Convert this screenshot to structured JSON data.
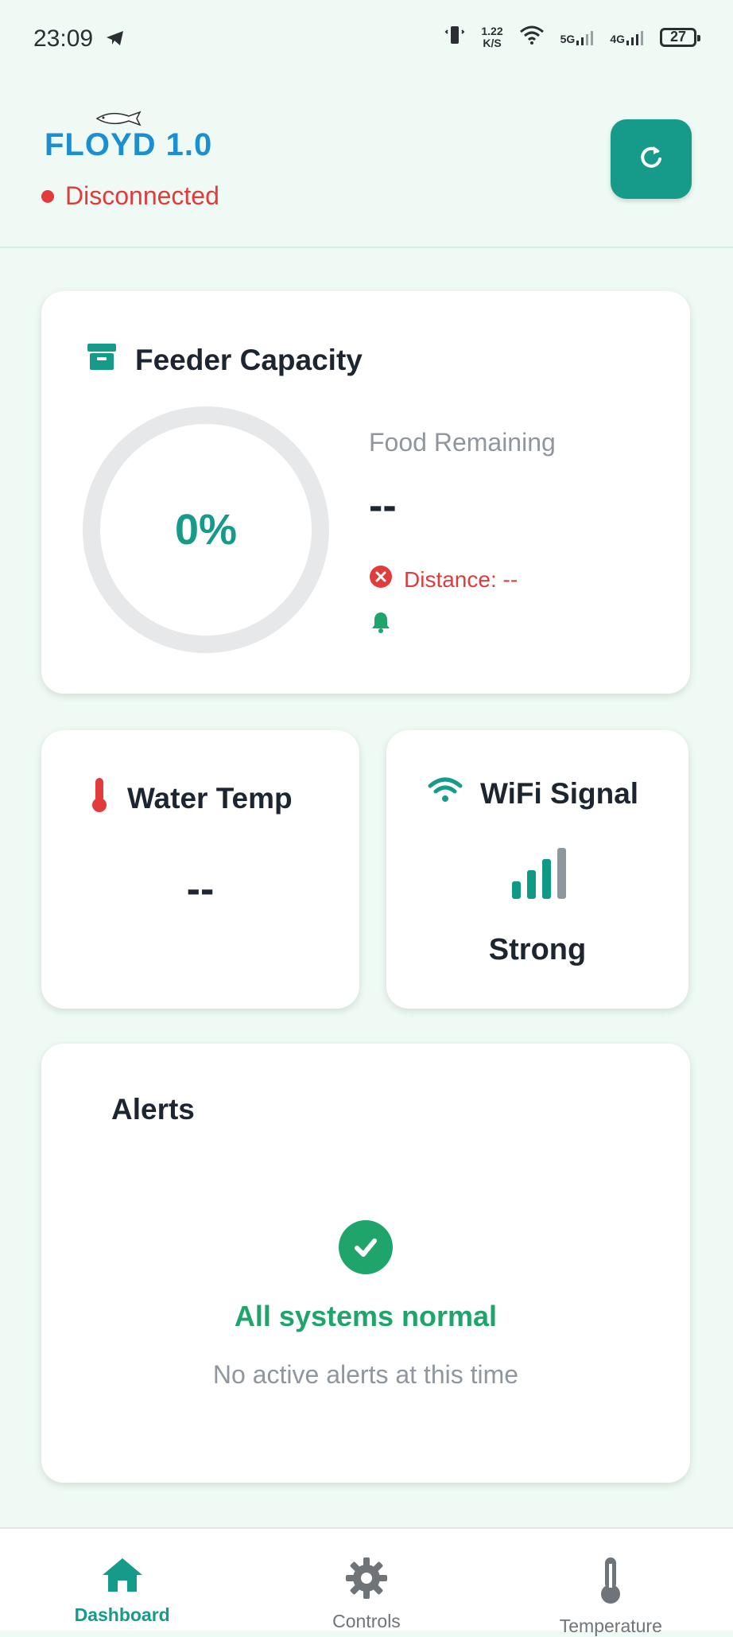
{
  "status_bar": {
    "time": "23:09",
    "speed_value": "1.22",
    "speed_unit": "K/S",
    "network_1": "5G",
    "network_2": "4G",
    "battery": "27"
  },
  "header": {
    "app_name": "FLOYD 1.0",
    "connection_status": "Disconnected",
    "refresh_icon": "refresh-icon"
  },
  "feeder": {
    "title": "Feeder Capacity",
    "percent": "0%",
    "food_label": "Food Remaining",
    "food_value": "--",
    "distance_text": "Distance: --"
  },
  "water_temp": {
    "title": "Water Temp",
    "value": "--"
  },
  "wifi": {
    "title": "WiFi Signal",
    "strength": "Strong"
  },
  "alerts": {
    "title": "Alerts",
    "status": "All systems normal",
    "message": "No active alerts at this time"
  },
  "nav": {
    "items": [
      {
        "label": "Dashboard"
      },
      {
        "label": "Controls"
      },
      {
        "label": "Temperature"
      }
    ]
  },
  "colors": {
    "primary": "#169b8a",
    "danger": "#e23b3b",
    "success": "#1fa56b",
    "background": "#eefaf3"
  }
}
